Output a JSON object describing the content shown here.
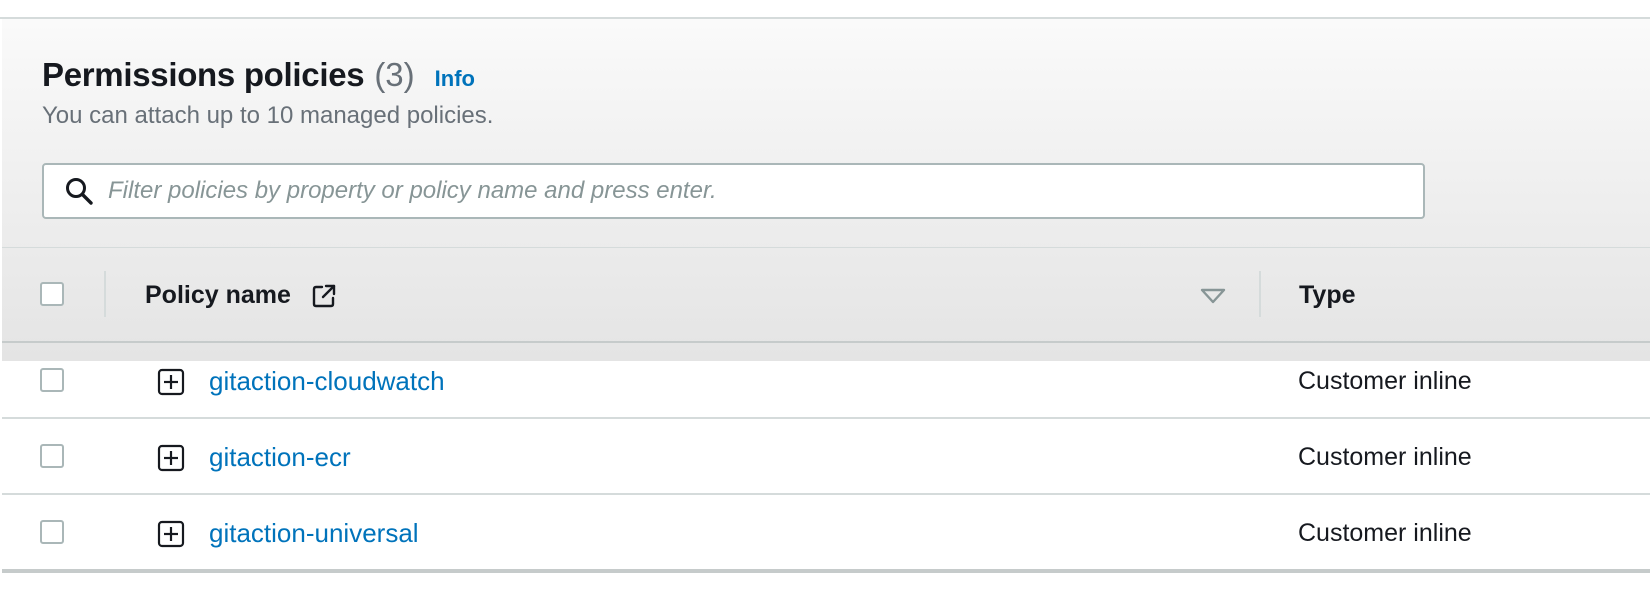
{
  "section": {
    "title": "Permissions policies",
    "count": "(3)",
    "info_label": "Info",
    "subtitle": "You can attach up to 10 managed policies."
  },
  "search": {
    "placeholder": "Filter policies by property or policy name and press enter.",
    "value": ""
  },
  "table": {
    "columns": {
      "policy_name": "Policy name",
      "type": "Type"
    },
    "rows": [
      {
        "name": "gitaction-cloudwatch",
        "type": "Customer inline"
      },
      {
        "name": "gitaction-ecr",
        "type": "Customer inline"
      },
      {
        "name": "gitaction-universal",
        "type": "Customer inline"
      }
    ]
  },
  "icons": {
    "search": "search-icon",
    "external_link": "external-link-icon",
    "sort": "sort-descending-icon",
    "expand": "expand-plus-icon"
  },
  "colors": {
    "link": "#0073bb",
    "text": "#16191f",
    "muted": "#687078",
    "border": "#aab7b8"
  }
}
